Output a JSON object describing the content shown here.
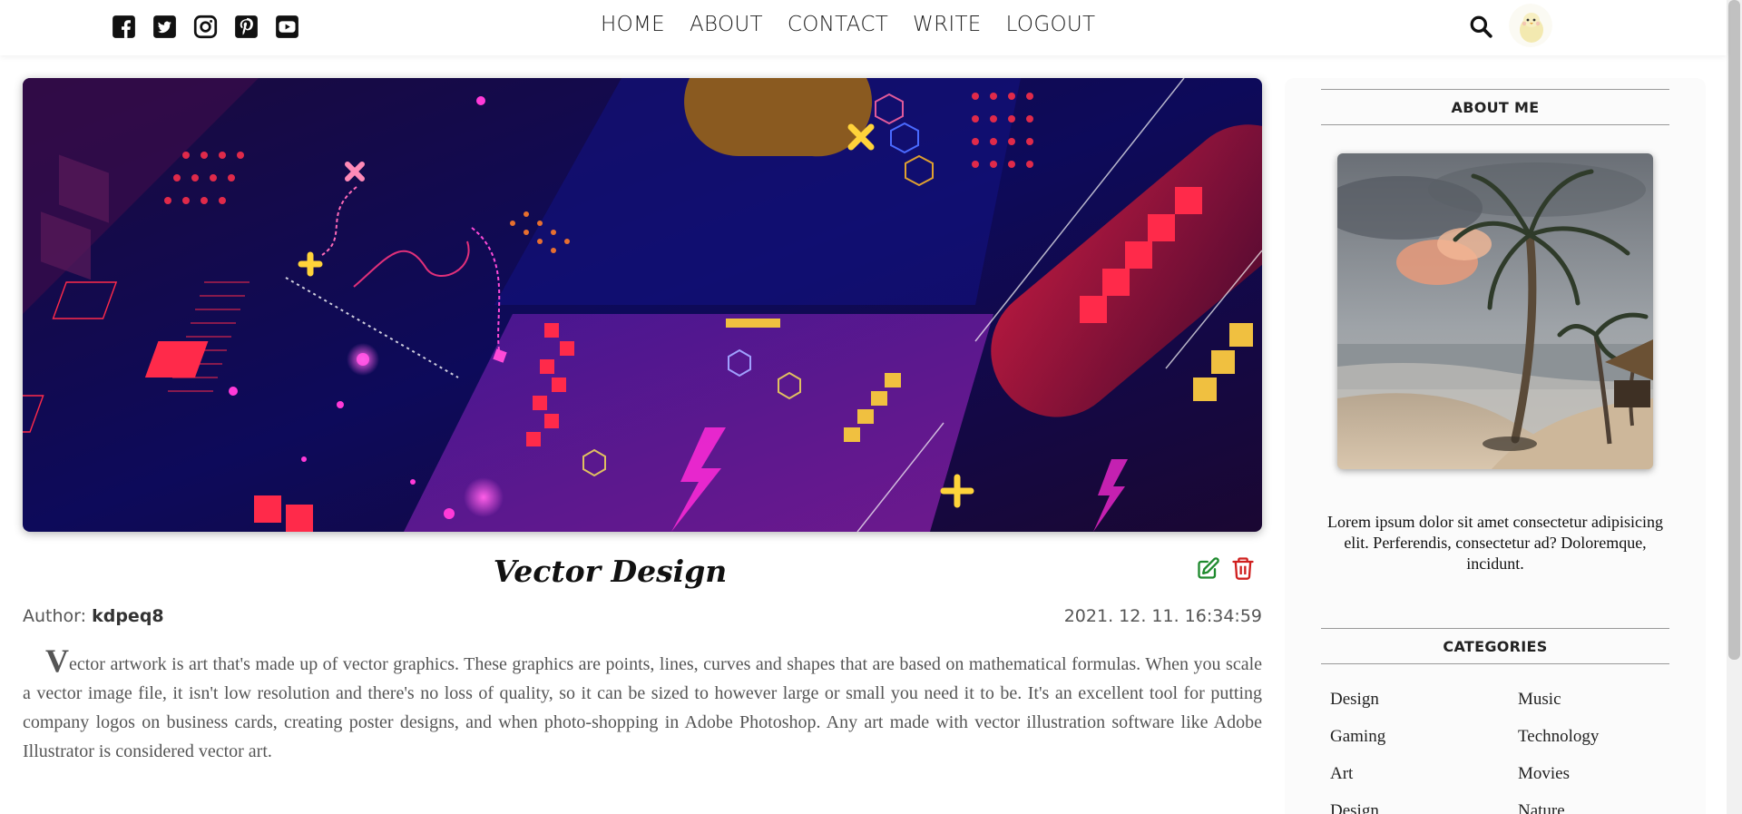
{
  "social_icons": [
    "facebook-icon",
    "twitter-icon",
    "instagram-icon",
    "pinterest-icon",
    "youtube-icon"
  ],
  "nav": {
    "items": [
      "HOME",
      "ABOUT",
      "CONTACT",
      "WRITE",
      "LOGOUT"
    ]
  },
  "post": {
    "title": "Vector Design",
    "author_label": "Author:",
    "author": "kdpeq8",
    "date": "2021. 12. 11. 16:34:59",
    "dropcap": "V",
    "body": "ector artwork is art that's made up of vector graphics. These graphics are points, lines, curves and shapes that are based on mathematical formulas. When you scale a vector image file, it isn't low resolution and there's no loss of quality, so it can be sized to however large or small you need it to be. It's an excellent tool for putting company logos on business cards, creating poster designs, and when photo-shopping in Adobe Photoshop. Any art made with vector illustration software like Adobe Illustrator is considered vector art."
  },
  "sidebar": {
    "about_title": "ABOUT ME",
    "about_text": "Lorem ipsum dolor sit amet consectetur adipisicing elit. Perferendis, consectetur ad? Doloremque, incidunt.",
    "categories_title": "CATEGORIES",
    "categories": [
      "Design",
      "Music",
      "Gaming",
      "Technology",
      "Art",
      "Movies",
      "Design",
      "Nature"
    ]
  },
  "colors": {
    "edit_icon": "#1f8a2e",
    "delete_icon": "#d0201f"
  }
}
